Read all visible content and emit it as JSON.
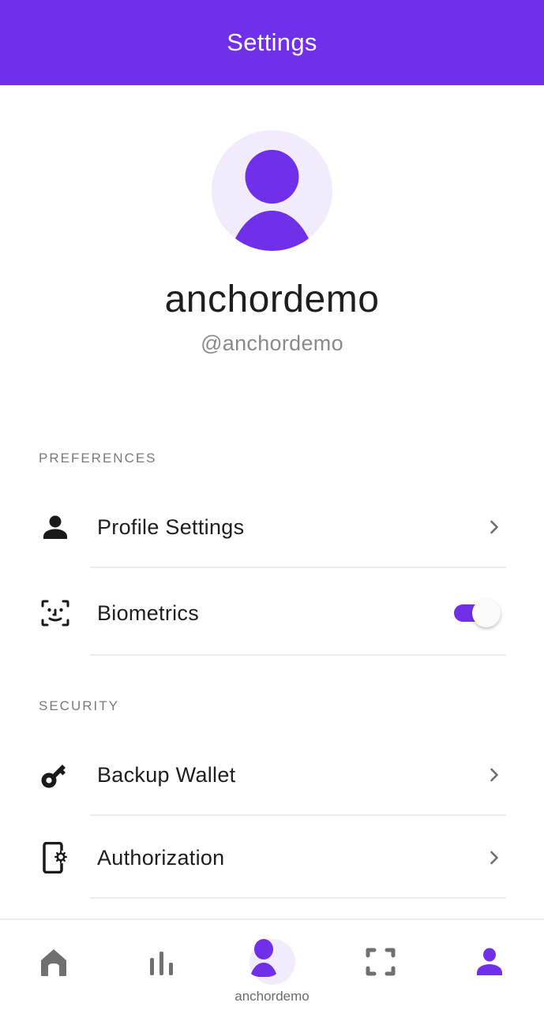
{
  "header": {
    "title": "Settings"
  },
  "profile": {
    "display_name": "anchordemo",
    "handle": "@anchordemo",
    "avatar_icon": "user-avatar-icon"
  },
  "sections": [
    {
      "label": "PREFERENCES",
      "items": [
        {
          "label": "Profile Settings",
          "icon": "person-icon",
          "control": "chevron"
        },
        {
          "label": "Biometrics",
          "icon": "face-id-icon",
          "control": "toggle",
          "enabled": true
        }
      ]
    },
    {
      "label": "SECURITY",
      "items": [
        {
          "label": "Backup Wallet",
          "icon": "key-icon",
          "control": "chevron"
        },
        {
          "label": "Authorization",
          "icon": "phone-settings-icon",
          "control": "chevron"
        }
      ]
    }
  ],
  "bottom_nav": {
    "items": [
      {
        "name": "home",
        "icon": "home-icon",
        "active": false
      },
      {
        "name": "stats",
        "icon": "bar-chart-icon",
        "active": false
      },
      {
        "name": "account",
        "icon": "avatar-icon",
        "label": "anchordemo",
        "active": false
      },
      {
        "name": "scan",
        "icon": "scan-icon",
        "active": false
      },
      {
        "name": "settings",
        "icon": "person-icon",
        "active": true
      }
    ]
  },
  "colors": {
    "accent": "#7030ea",
    "accent_light": "#f1ebfc",
    "inactive_icon": "#707070",
    "text_primary": "#1e1e1e",
    "text_secondary": "#8a8a8a"
  }
}
